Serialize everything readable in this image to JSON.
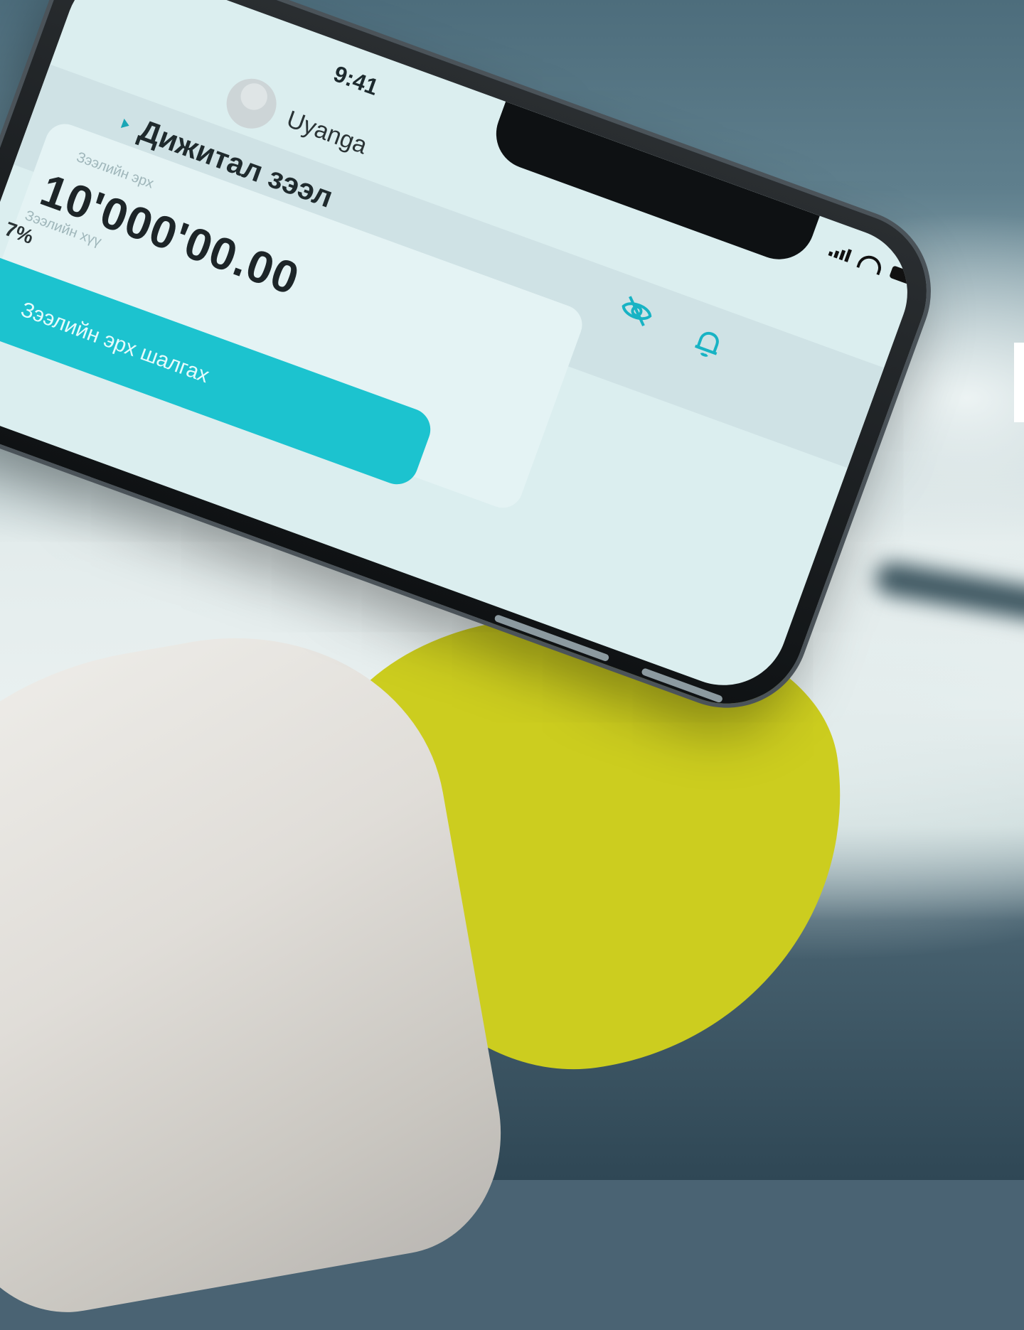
{
  "status_bar": {
    "time": "9:41"
  },
  "profile": {
    "username": "Uyanga"
  },
  "section": {
    "title": "Дижитал зээл"
  },
  "loan": {
    "amount_label": "Зээлийн эрх",
    "amount_value": "10'000'00.00",
    "rate_label": "Зээлийн хүү",
    "rate_value": "7%"
  },
  "actions": {
    "check_limit_label": "Зээлийн эрх шалгах"
  },
  "colors": {
    "accent": "#1cc3cf",
    "yellow": "#cccd1f"
  }
}
